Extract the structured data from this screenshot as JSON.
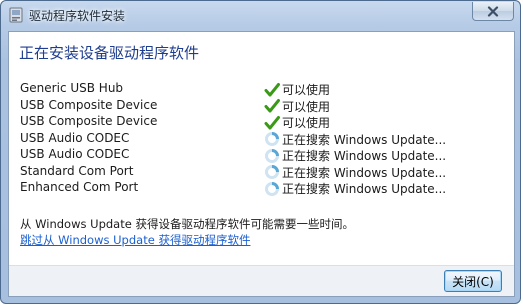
{
  "window": {
    "title": "驱动程序软件安装",
    "icon": "device-driver-icon",
    "close_glyph": "✕"
  },
  "main": {
    "heading": "正在安装设备驱动程序软件",
    "devices": [
      {
        "name": "Generic USB Hub",
        "status": "可以使用",
        "icon": "checkmark-icon"
      },
      {
        "name": "USB Composite Device",
        "status": "可以使用",
        "icon": "checkmark-icon"
      },
      {
        "name": "USB Composite Device",
        "status": "可以使用",
        "icon": "checkmark-icon"
      },
      {
        "name": "USB Audio CODEC",
        "status": "正在搜索 Windows Update...",
        "icon": "busy-spinner-icon"
      },
      {
        "name": "USB Audio CODEC",
        "status": "正在搜索 Windows Update...",
        "icon": "busy-spinner-icon"
      },
      {
        "name": "Standard Com Port",
        "status": "正在搜索 Windows Update...",
        "icon": "busy-spinner-icon"
      },
      {
        "name": "Enhanced Com Port",
        "status": "正在搜索 Windows Update...",
        "icon": "busy-spinner-icon"
      }
    ],
    "info_text": "从 Windows Update 获得设备驱动程序软件可能需要一些时间。",
    "skip_link": "跳过从 Windows Update 获得驱动程序软件"
  },
  "footer": {
    "close_button": "关闭(C)"
  },
  "colors": {
    "heading": "#1e3d8f",
    "link": "#1a5fd0",
    "check": "#3a9a18",
    "spinner": "#5aa6d6"
  }
}
